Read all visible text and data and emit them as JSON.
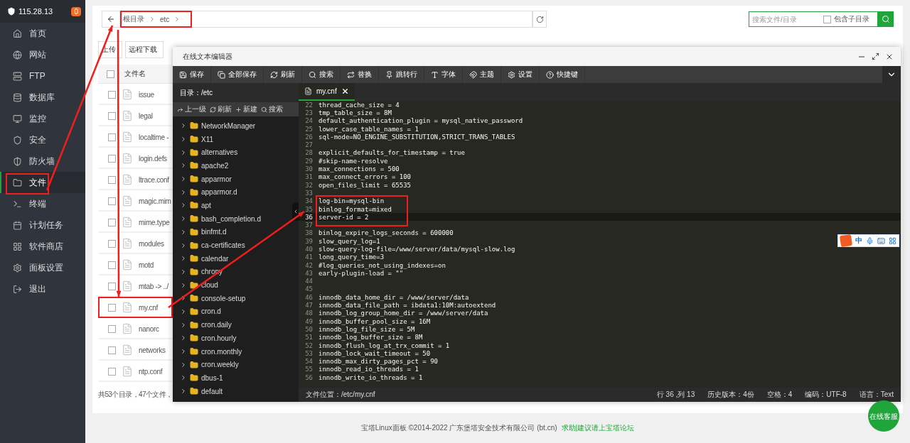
{
  "sidebar": {
    "host": "115.28.13",
    "badge": "0",
    "items": [
      {
        "label": "首页",
        "selected": false,
        "highlighted": false
      },
      {
        "label": "网站",
        "selected": false,
        "highlighted": false
      },
      {
        "label": "FTP",
        "selected": false,
        "highlighted": false
      },
      {
        "label": "数据库",
        "selected": false,
        "highlighted": false
      },
      {
        "label": "监控",
        "selected": false,
        "highlighted": false
      },
      {
        "label": "安全",
        "selected": false,
        "highlighted": false
      },
      {
        "label": "防火墙",
        "selected": false,
        "highlighted": false
      },
      {
        "label": "文件",
        "selected": true,
        "highlighted": true
      },
      {
        "label": "终端",
        "selected": false,
        "highlighted": false
      },
      {
        "label": "计划任务",
        "selected": false,
        "highlighted": false
      },
      {
        "label": "软件商店",
        "selected": false,
        "highlighted": false
      },
      {
        "label": "面板设置",
        "selected": false,
        "highlighted": false
      },
      {
        "label": "退出",
        "selected": false,
        "highlighted": false
      }
    ]
  },
  "file_manager": {
    "breadcrumb": [
      "根目录",
      "etc"
    ],
    "breadcrumb_highlighted": true,
    "search": {
      "placeholder": "搜索文件/目录",
      "include_subdirs_label": "包含子目录",
      "include_subdirs": false
    },
    "buttons": [
      "上传",
      "远程下载"
    ],
    "select_all": false,
    "columns": [
      "文件名"
    ],
    "rows": [
      {
        "name": "issue",
        "checked": false,
        "highlighted": false
      },
      {
        "name": "legal",
        "checked": false,
        "highlighted": false
      },
      {
        "name": "localtime -",
        "checked": false,
        "highlighted": false
      },
      {
        "name": "login.defs",
        "checked": false,
        "highlighted": false
      },
      {
        "name": "ltrace.conf",
        "checked": false,
        "highlighted": false
      },
      {
        "name": "magic.mim",
        "checked": false,
        "highlighted": false
      },
      {
        "name": "mime.type",
        "checked": false,
        "highlighted": false
      },
      {
        "name": "modules",
        "checked": false,
        "highlighted": false
      },
      {
        "name": "motd",
        "checked": false,
        "highlighted": false
      },
      {
        "name": "mtab -> ../",
        "checked": false,
        "highlighted": false
      },
      {
        "name": "my.cnf",
        "checked": false,
        "highlighted": true
      },
      {
        "name": "nanorc",
        "checked": false,
        "highlighted": false
      },
      {
        "name": "networks",
        "checked": false,
        "highlighted": false
      },
      {
        "name": "ntp.conf",
        "checked": false,
        "highlighted": false
      }
    ],
    "summary": "共53个目录，47个文件，"
  },
  "editor": {
    "title": "在线文本编辑器",
    "toolbar": [
      "保存",
      "全部保存",
      "刷新",
      "搜索",
      "替换",
      "跳转行",
      "字体",
      "主题",
      "设置",
      "快捷键"
    ],
    "directory": "目录：/etc",
    "tree_actions": [
      "上一级",
      "刷新",
      "新建",
      "搜索"
    ],
    "tree": [
      "NetworkManager",
      "X11",
      "alternatives",
      "apache2",
      "apparmor",
      "apparmor.d",
      "apt",
      "bash_completion.d",
      "binfmt.d",
      "ca-certificates",
      "calendar",
      "chrony",
      "cloud",
      "console-setup",
      "cron.d",
      "cron.daily",
      "cron.hourly",
      "cron.monthly",
      "cron.weekly",
      "dbus-1",
      "default"
    ],
    "tab": {
      "label": "my.cnf",
      "selected": true
    },
    "lines": [
      {
        "kind": "line",
        "number": "22",
        "text": "thread_cache_size = 4",
        "current": false
      },
      {
        "kind": "line",
        "number": "23",
        "text": "tmp_table_size = 8M",
        "current": false
      },
      {
        "kind": "line",
        "number": "24",
        "text": "default_authentication_plugin = mysql_native_password",
        "current": false
      },
      {
        "kind": "line",
        "number": "25",
        "text": "lower_case_table_names = 1",
        "current": false
      },
      {
        "kind": "line",
        "number": "26",
        "text": "sql-mode=NO_ENGINE_SUBSTITUTION,STRICT_TRANS_TABLES",
        "current": false
      },
      {
        "kind": "line",
        "number": "27",
        "current": false
      },
      {
        "kind": "line",
        "number": "28",
        "text": "explicit_defaults_for_timestamp = true",
        "current": false
      },
      {
        "kind": "line",
        "number": "29",
        "text": "#skip-name-resolve",
        "current": false
      },
      {
        "kind": "line",
        "number": "30",
        "text": "max_connections = 500",
        "current": false
      },
      {
        "kind": "line",
        "number": "31",
        "text": "max_connect_errors = 100",
        "current": false
      },
      {
        "kind": "line",
        "number": "32",
        "text": "open_files_limit = 65535",
        "current": false
      },
      {
        "kind": "line",
        "number": "33",
        "current": false
      },
      {
        "kind": "highlighted_block",
        "lines": [
          {
            "number": "34",
            "text": "log-bin=mysql-bin",
            "current": false
          },
          {
            "number": "35",
            "text": "binlog_format=mixed",
            "current": false
          },
          {
            "number": "36",
            "text": "server-id = 2",
            "current": true
          }
        ]
      },
      {
        "kind": "line",
        "number": "37",
        "current": false
      },
      {
        "kind": "line",
        "number": "38",
        "text": "binlog_expire_logs_seconds = 600000",
        "current": false
      },
      {
        "kind": "line",
        "number": "39",
        "text": "slow_query_log=1",
        "current": false
      },
      {
        "kind": "line",
        "number": "40",
        "text": "slow-query-log-file=/www/server/data/mysql-slow.log",
        "current": false
      },
      {
        "kind": "line",
        "number": "41",
        "text": "long_query_time=3",
        "current": false
      },
      {
        "kind": "line",
        "number": "42",
        "text": "#log_queries_not_using_indexes=on",
        "current": false
      },
      {
        "kind": "line",
        "number": "43",
        "text": "early-plugin-load = \"\"",
        "current": false
      },
      {
        "kind": "line",
        "number": "44",
        "current": false
      },
      {
        "kind": "line",
        "number": "45",
        "current": false
      },
      {
        "kind": "line",
        "number": "46",
        "text": "innodb_data_home_dir = /www/server/data",
        "current": false
      },
      {
        "kind": "line",
        "number": "47",
        "text": "innodb_data_file_path = ibdata1:10M:autoextend",
        "current": false
      },
      {
        "kind": "line",
        "number": "48",
        "text": "innodb_log_group_home_dir = /www/server/data",
        "current": false
      },
      {
        "kind": "line",
        "number": "49",
        "text": "innodb_buffer_pool_size = 16M",
        "current": false
      },
      {
        "kind": "line",
        "number": "50",
        "text": "innodb_log_file_size = 5M",
        "current": false
      },
      {
        "kind": "line",
        "number": "51",
        "text": "innodb_log_buffer_size = 8M",
        "current": false
      },
      {
        "kind": "line",
        "number": "52",
        "text": "innodb_flush_log_at_trx_commit = 1",
        "current": false
      },
      {
        "kind": "line",
        "number": "53",
        "text": "innodb_lock_wait_timeout = 50",
        "current": false
      },
      {
        "kind": "line",
        "number": "54",
        "text": "innodb_max_dirty_pages_pct = 90",
        "current": false
      },
      {
        "kind": "line",
        "number": "55",
        "text": "innodb_read_io_threads = 1",
        "current": false
      },
      {
        "kind": "line",
        "number": "56",
        "text": "innodb_write_io_threads = 1",
        "current": false
      }
    ],
    "status": {
      "path": "文件位置：/etc/my.cnf",
      "items": [
        "行 36 ,列 13",
        "历史版本：4份",
        "空格：4",
        "编码：UTF-8",
        "语言：Text"
      ]
    }
  },
  "ime": {
    "mode": "中"
  },
  "chat_button": "在线客服",
  "footer": {
    "copyright": "宝塔Linux面板 ©2014-2022 广东堡塔安全技术有限公司 (bt.cn)",
    "link": "求助|建议请上宝塔论坛"
  }
}
